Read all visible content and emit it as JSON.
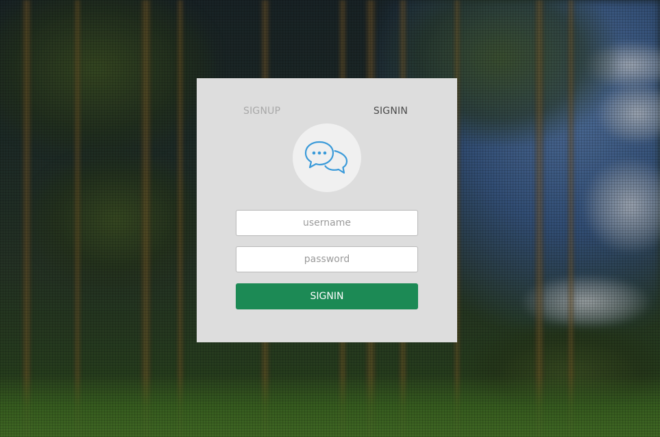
{
  "tabs": {
    "signup_label": "SIGNUP",
    "signin_label": "SIGNIN",
    "active": "signin"
  },
  "logo": {
    "icon": "chat-bubbles-icon",
    "color": "#3a9ad9"
  },
  "form": {
    "username_placeholder": "username",
    "username_value": "",
    "password_placeholder": "password",
    "password_value": "",
    "submit_label": "SIGNIN"
  },
  "colors": {
    "card_background": "#dddddd",
    "submit_button": "#1c8a55",
    "tab_active": "#4a4a4a",
    "tab_inactive": "#a8a8a8"
  }
}
